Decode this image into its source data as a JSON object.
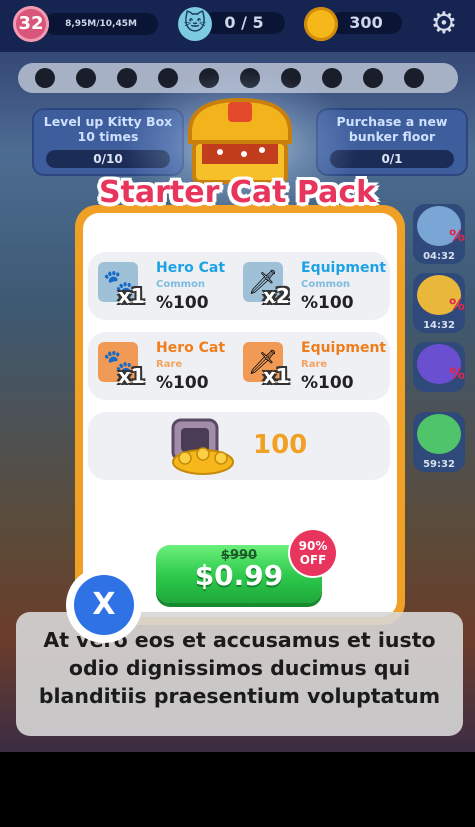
{
  "hud": {
    "level": "32",
    "xp": "8,95M/10,45M",
    "cats": "0 / 5",
    "coins": "300",
    "settings_icon": "gear-icon"
  },
  "quests": [
    {
      "title": "Level up Kitty Box 10 times",
      "progress": "0/10"
    },
    {
      "title": "Purchase a new bunker floor",
      "progress": "0/1"
    }
  ],
  "side_timers": [
    {
      "time": "04:32",
      "badge": "%"
    },
    {
      "time": "14:32",
      "badge": "%"
    },
    {
      "time": "",
      "badge": "%"
    },
    {
      "time": "59:32",
      "badge": ""
    }
  ],
  "modal": {
    "title": "Starter Cat Pack",
    "items": [
      {
        "name": "Hero Cat",
        "rarity": "Common",
        "qty": "x1",
        "chance": "%100",
        "icon": "paw-icon"
      },
      {
        "name": "Equipment",
        "rarity": "Common",
        "qty": "x2",
        "chance": "%100",
        "icon": "sword-icon"
      },
      {
        "name": "Hero Cat",
        "rarity": "Rare",
        "qty": "x1",
        "chance": "%100",
        "icon": "paw-icon"
      },
      {
        "name": "Equipment",
        "rarity": "Rare",
        "qty": "x1",
        "chance": "%100",
        "icon": "sword-icon"
      }
    ],
    "coins_reward": "100",
    "old_price": "$990",
    "price": "$0.99",
    "discount_pct": "90%",
    "discount_label": "OFF",
    "close_label": "X"
  },
  "caption": "At vero eos et accusamus et iusto odio dignissimos ducimus qui blanditiis praesentium voluptatum",
  "colors": {
    "title_pink": "#e8355d",
    "modal_orange": "#f0a024",
    "common_blue": "#1ea2e6",
    "rare_orange": "#f07d1b",
    "buy_green": "#2cc84b",
    "close_blue": "#2f72e6"
  }
}
